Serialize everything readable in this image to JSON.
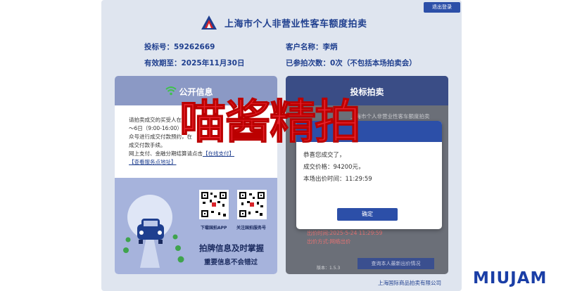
{
  "header": {
    "title": "上海市个人非营业性客车额度拍卖",
    "logout_label": "退出登录"
  },
  "info": {
    "bid_number": "投标号：59262669",
    "customer_name": "客户名称：李炳",
    "valid_until": "有效期至：2025年11月30日",
    "attended_count": "已参拍次数：0次（不包括本场拍卖会）"
  },
  "left_panel": {
    "title": "公开信息",
    "notice_lines": [
      "请拍卖成交的买受人在",
      "～6日（9:00-16:00）期间",
      "众号进行成交付款预约，在",
      "成交付款手续。",
      "网上支付、金融分期结算请点击"
    ],
    "link_online_pay": "【在线支付】",
    "link_service_address": "【查看服务点地址】",
    "qr1_label": "下载国拍APP",
    "qr2_label": "关注国拍服务号",
    "slogan_main": "拍牌信息及时掌握",
    "slogan_sub": "重要信息不会错过"
  },
  "right_panel": {
    "title": "投标拍卖",
    "bg_line1": "上海市个人非营业性客车额度拍卖",
    "red_line1": "出价时间:2025-5-24 11:29:59",
    "red_line2": "出价方式:网络出价",
    "version": "版本：1.5.3",
    "query_button": "查询本人最新出价情况"
  },
  "modal": {
    "line1": "恭喜您成交了，",
    "line2": "成交价格：94200元，",
    "line3": "本场出价时间：11:29:59",
    "confirm_label": "确定"
  },
  "footer": {
    "company": "上海国际商品拍卖有限公司"
  },
  "overlay": {
    "watermark": "喵酱精拍",
    "brand": "MIUJAM"
  },
  "colors": {
    "primary": "#2c4fa8",
    "title_text": "#1f3f8f",
    "watermark": "#e5202a",
    "frame_bg": "#dfe5ef"
  }
}
